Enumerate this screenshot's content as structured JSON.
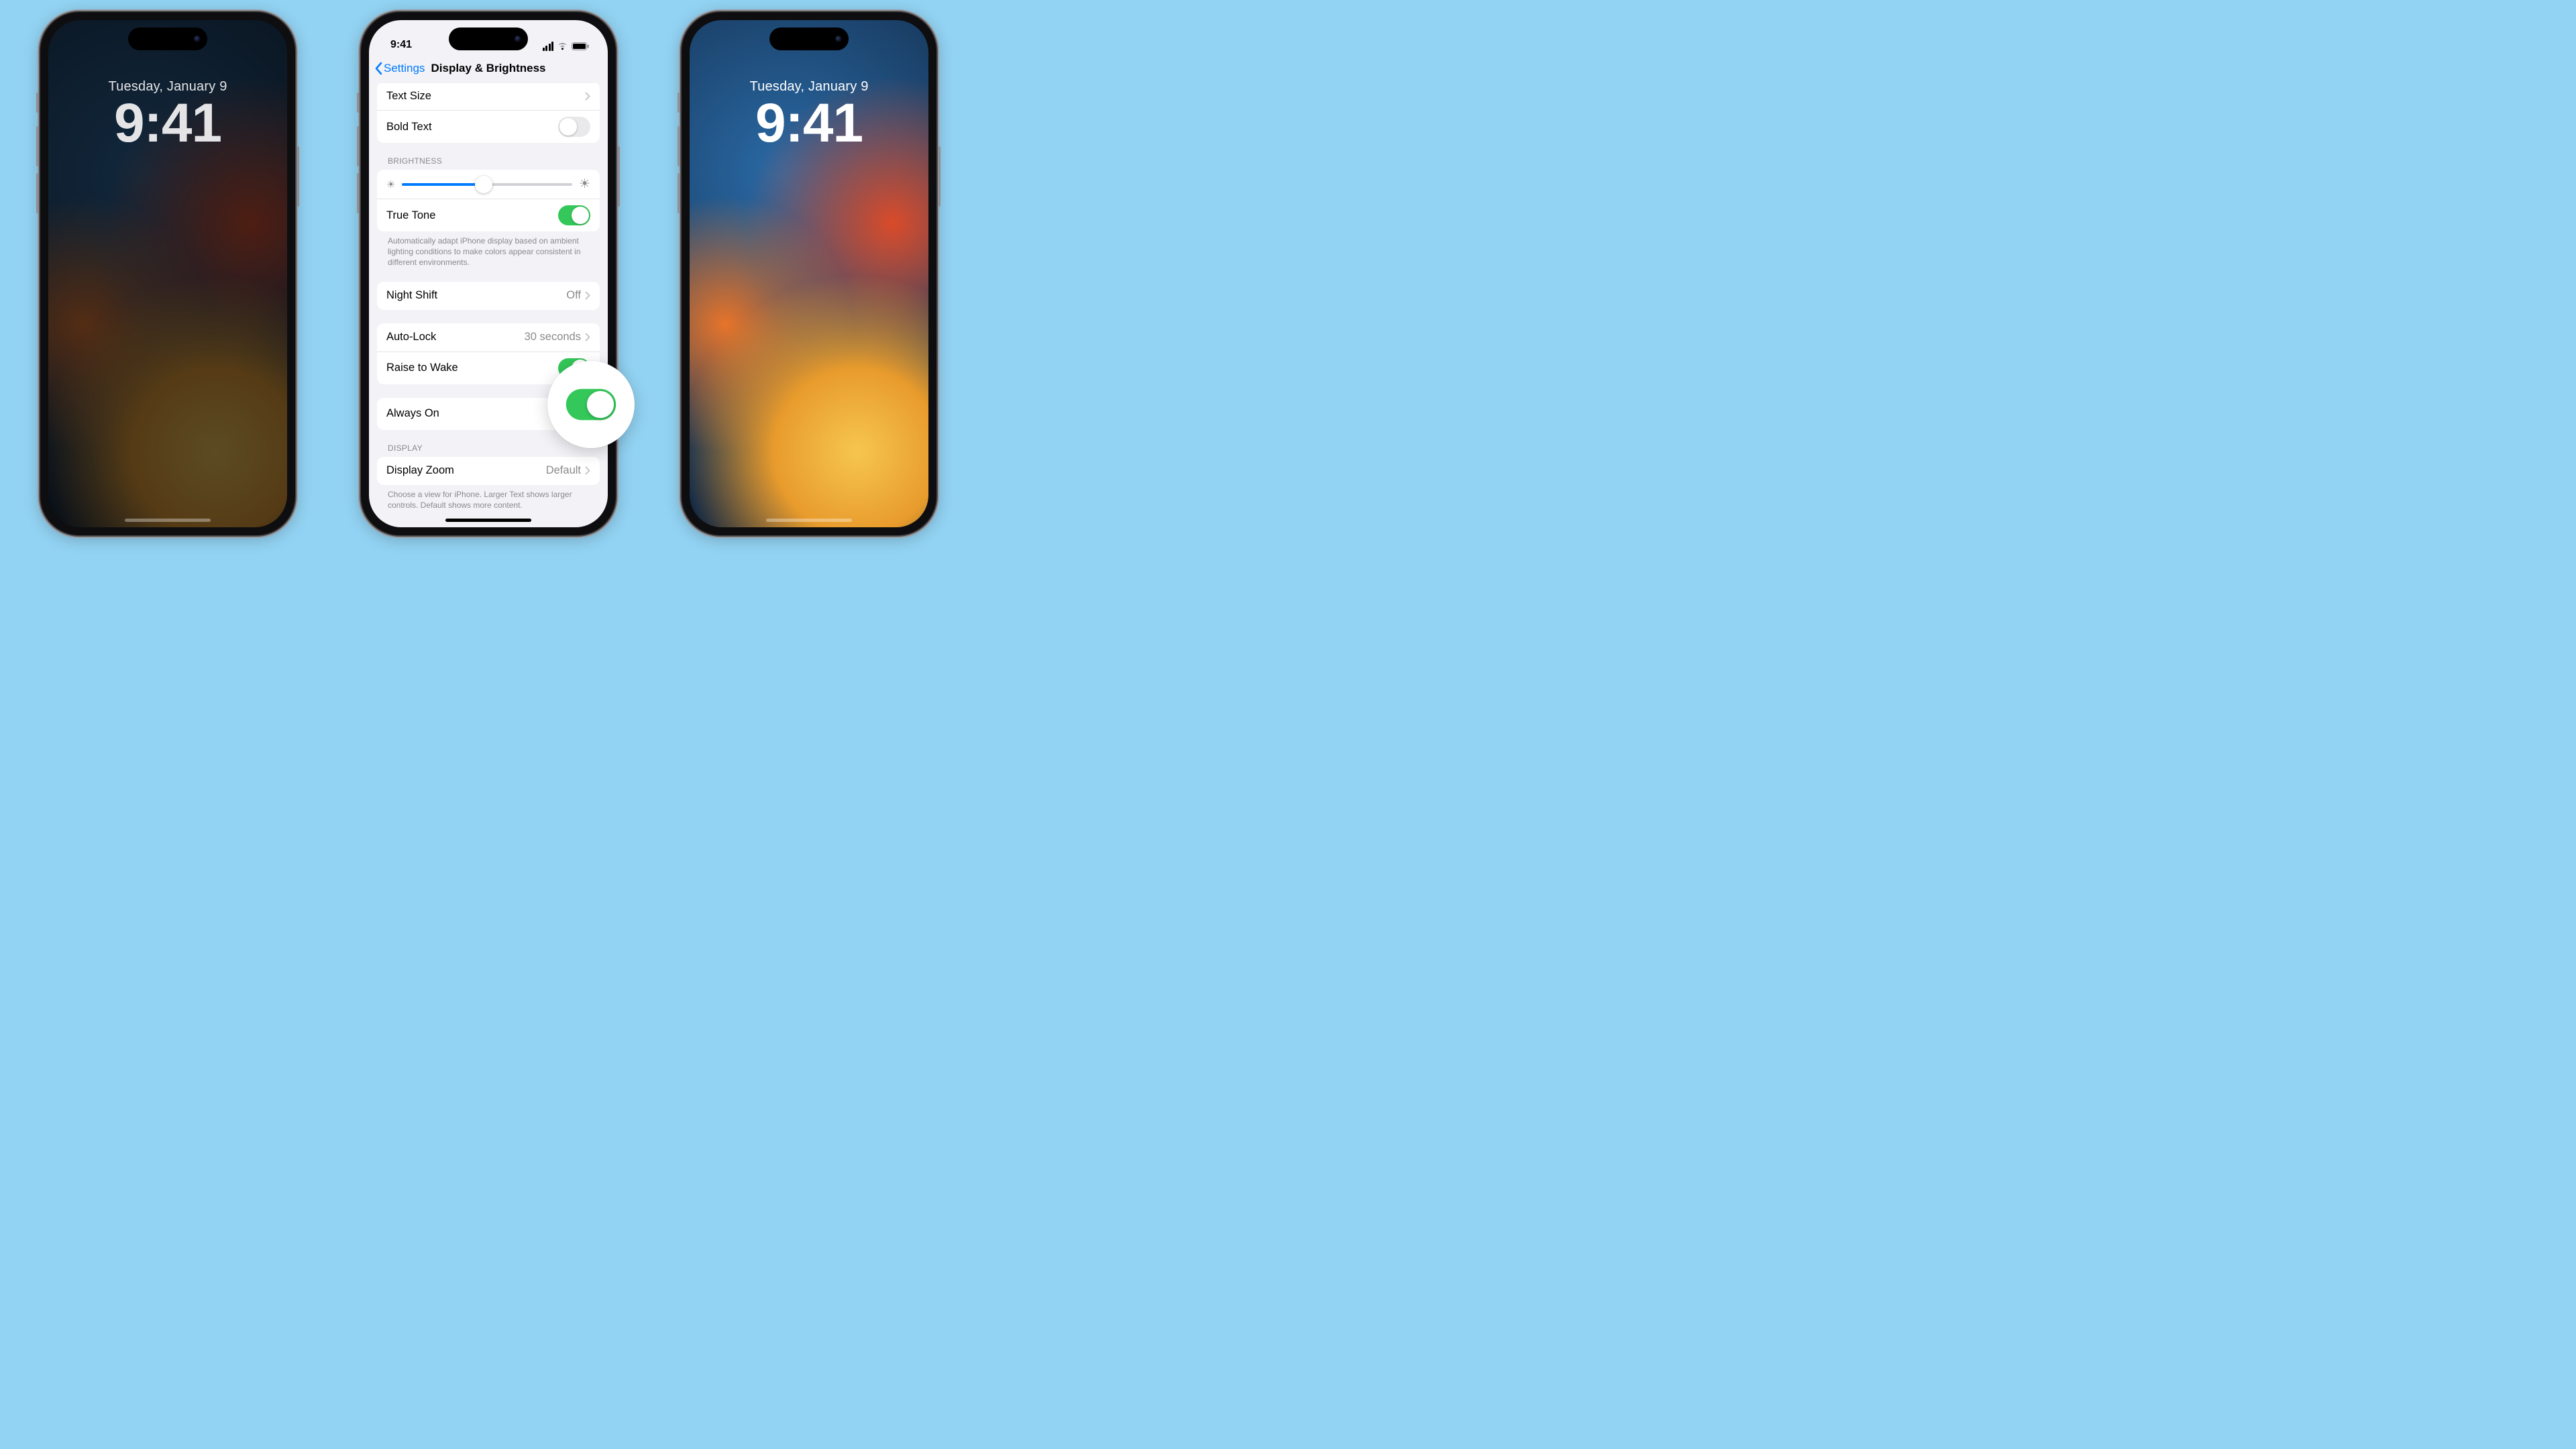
{
  "lock_screen": {
    "date": "Tuesday, January 9",
    "time": "9:41"
  },
  "status_bar": {
    "time": "9:41"
  },
  "nav": {
    "back_label": "Settings",
    "title": "Display & Brightness"
  },
  "rows": {
    "text_size": "Text Size",
    "bold_text": "Bold Text",
    "true_tone": "True Tone",
    "night_shift": "Night Shift",
    "night_shift_value": "Off",
    "auto_lock": "Auto-Lock",
    "auto_lock_value": "30 seconds",
    "raise_to_wake": "Raise to Wake",
    "always_on": "Always On",
    "display_zoom": "Display Zoom",
    "display_zoom_value": "Default"
  },
  "section_headers": {
    "brightness": "BRIGHTNESS",
    "display": "DISPLAY"
  },
  "footers": {
    "true_tone": "Automatically adapt iPhone display based on ambient lighting conditions to make colors appear consistent in different environments.",
    "display_zoom": "Choose a view for iPhone. Larger Text shows larger controls. Default shows more content."
  },
  "toggles": {
    "bold_text": false,
    "true_tone": true,
    "raise_to_wake": true,
    "always_on": true
  },
  "brightness_slider_percent": 48
}
